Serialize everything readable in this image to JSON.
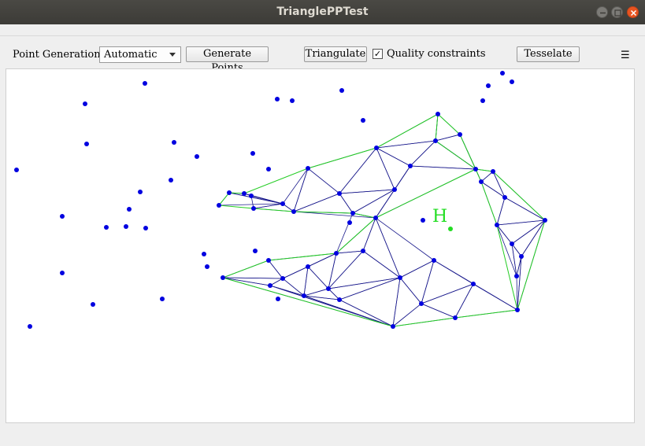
{
  "window": {
    "title": "TrianglePPTest"
  },
  "toolbar": {
    "point_generation_label": "Point Generation",
    "point_generation_value": "Automatic",
    "generate_points_label": "Generate Points",
    "triangulate_label": "Triangulate",
    "quality_checkbox_checked": true,
    "quality_label": "Quality constraints",
    "tesselate_label": "Tesselate",
    "menu_icon": "hamburger-icon"
  },
  "canvas": {
    "hole_marker_label": "H",
    "colors": {
      "point": "#0000e0",
      "mesh": "#1a1a8c",
      "boundary": "#22cc22",
      "hole_marker": "#22dd22"
    }
  }
}
